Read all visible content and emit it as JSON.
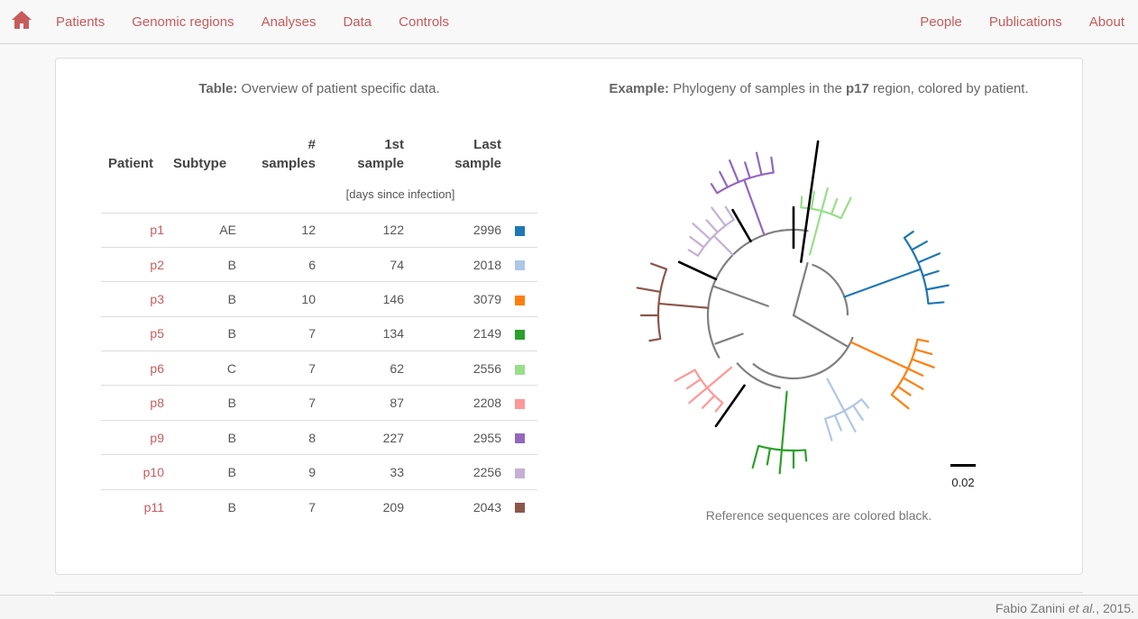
{
  "nav": {
    "left": [
      "Patients",
      "Genomic regions",
      "Analyses",
      "Data",
      "Controls"
    ],
    "right": [
      "People",
      "Publications",
      "About"
    ],
    "home_icon": "home-icon"
  },
  "table_caption": {
    "label": "Table:",
    "text": " Overview of patient specific data."
  },
  "table": {
    "headers": {
      "patient": "Patient",
      "subtype": "Subtype",
      "samples_1": "#",
      "samples_2": "samples",
      "first_1": "1st",
      "first_2": "sample",
      "last_1": "Last",
      "last_2": "sample"
    },
    "units": "[days since infection]",
    "rows": [
      {
        "patient": "p1",
        "subtype": "AE",
        "samples": "12",
        "first": "122",
        "last": "2996",
        "color": "#1f77b4"
      },
      {
        "patient": "p2",
        "subtype": "B",
        "samples": "6",
        "first": "74",
        "last": "2018",
        "color": "#aec7e8"
      },
      {
        "patient": "p3",
        "subtype": "B",
        "samples": "10",
        "first": "146",
        "last": "3079",
        "color": "#ff7f0e"
      },
      {
        "patient": "p5",
        "subtype": "B",
        "samples": "7",
        "first": "134",
        "last": "2149",
        "color": "#2ca02c"
      },
      {
        "patient": "p6",
        "subtype": "C",
        "samples": "7",
        "first": "62",
        "last": "2556",
        "color": "#98df8a"
      },
      {
        "patient": "p8",
        "subtype": "B",
        "samples": "7",
        "first": "87",
        "last": "2208",
        "color": "#ff9896"
      },
      {
        "patient": "p9",
        "subtype": "B",
        "samples": "8",
        "first": "227",
        "last": "2955",
        "color": "#9467bd"
      },
      {
        "patient": "p10",
        "subtype": "B",
        "samples": "9",
        "first": "33",
        "last": "2256",
        "color": "#c5b0d5"
      },
      {
        "patient": "p11",
        "subtype": "B",
        "samples": "7",
        "first": "209",
        "last": "2043",
        "color": "#8c564b"
      }
    ]
  },
  "figure": {
    "caption_label": "Example:",
    "caption_pre": " Phylogeny of samples in the ",
    "caption_region": "p17",
    "caption_post": " region, colored by patient.",
    "scale_label": "0.02",
    "note": "Reference sequences are colored black.",
    "reference_color": "#000000",
    "internal_color": "#808080"
  },
  "footer": {
    "name": "Fabio Zanini ",
    "etal": "et al.",
    "year": ", 2015."
  }
}
